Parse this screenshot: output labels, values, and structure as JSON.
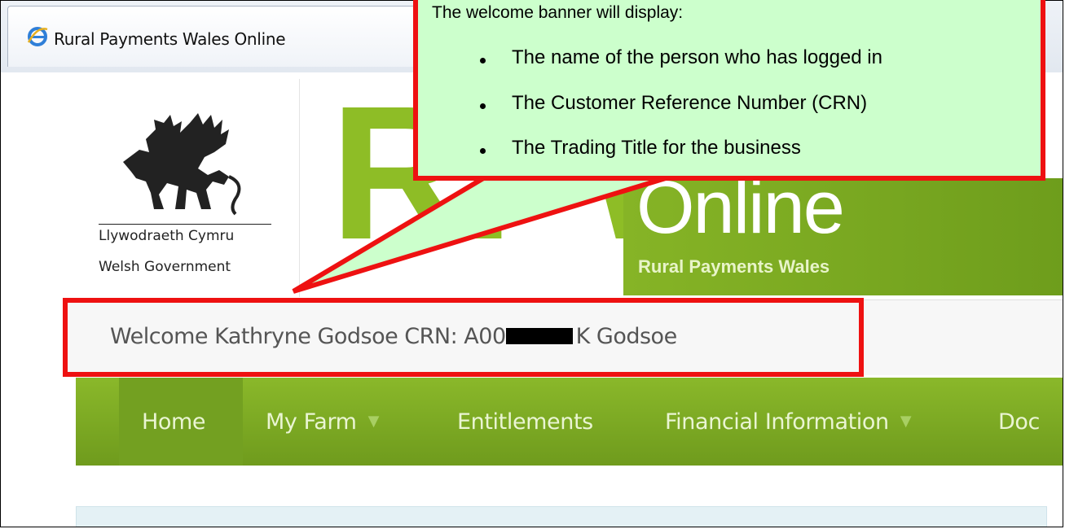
{
  "browser": {
    "tab_title": "Rural Payments Wales Online",
    "tab_icon": "internet-explorer-icon"
  },
  "header": {
    "logo_icon": "welsh-dragon-icon",
    "gov_name_welsh": "Llywodraeth Cymru",
    "gov_name_english": "Welsh Government",
    "brand_mark": "RPW",
    "brand_online": "Online",
    "brand_subtitle": "Rural Payments Wales"
  },
  "welcome": {
    "prefix": "Welcome Kathryne Godsoe CRN: A00",
    "suffix": "K Godsoe"
  },
  "nav": {
    "items": [
      {
        "label": "Home"
      },
      {
        "label": "My Farm"
      },
      {
        "label": "Entitlements"
      },
      {
        "label": "Financial Information"
      },
      {
        "label": "Doc"
      }
    ],
    "caret_icon": "caret-down-icon"
  },
  "callout": {
    "heading": "The welcome banner will display:",
    "bullets": [
      "The name of the person who has logged in",
      "The Customer Reference Number (CRN)",
      "The Trading Title for the business"
    ]
  },
  "colors": {
    "brand_green": "#8ebd26",
    "nav_green": "#7aa823",
    "callout_fill": "#ccffcc",
    "annotation_red": "#ee1111"
  }
}
